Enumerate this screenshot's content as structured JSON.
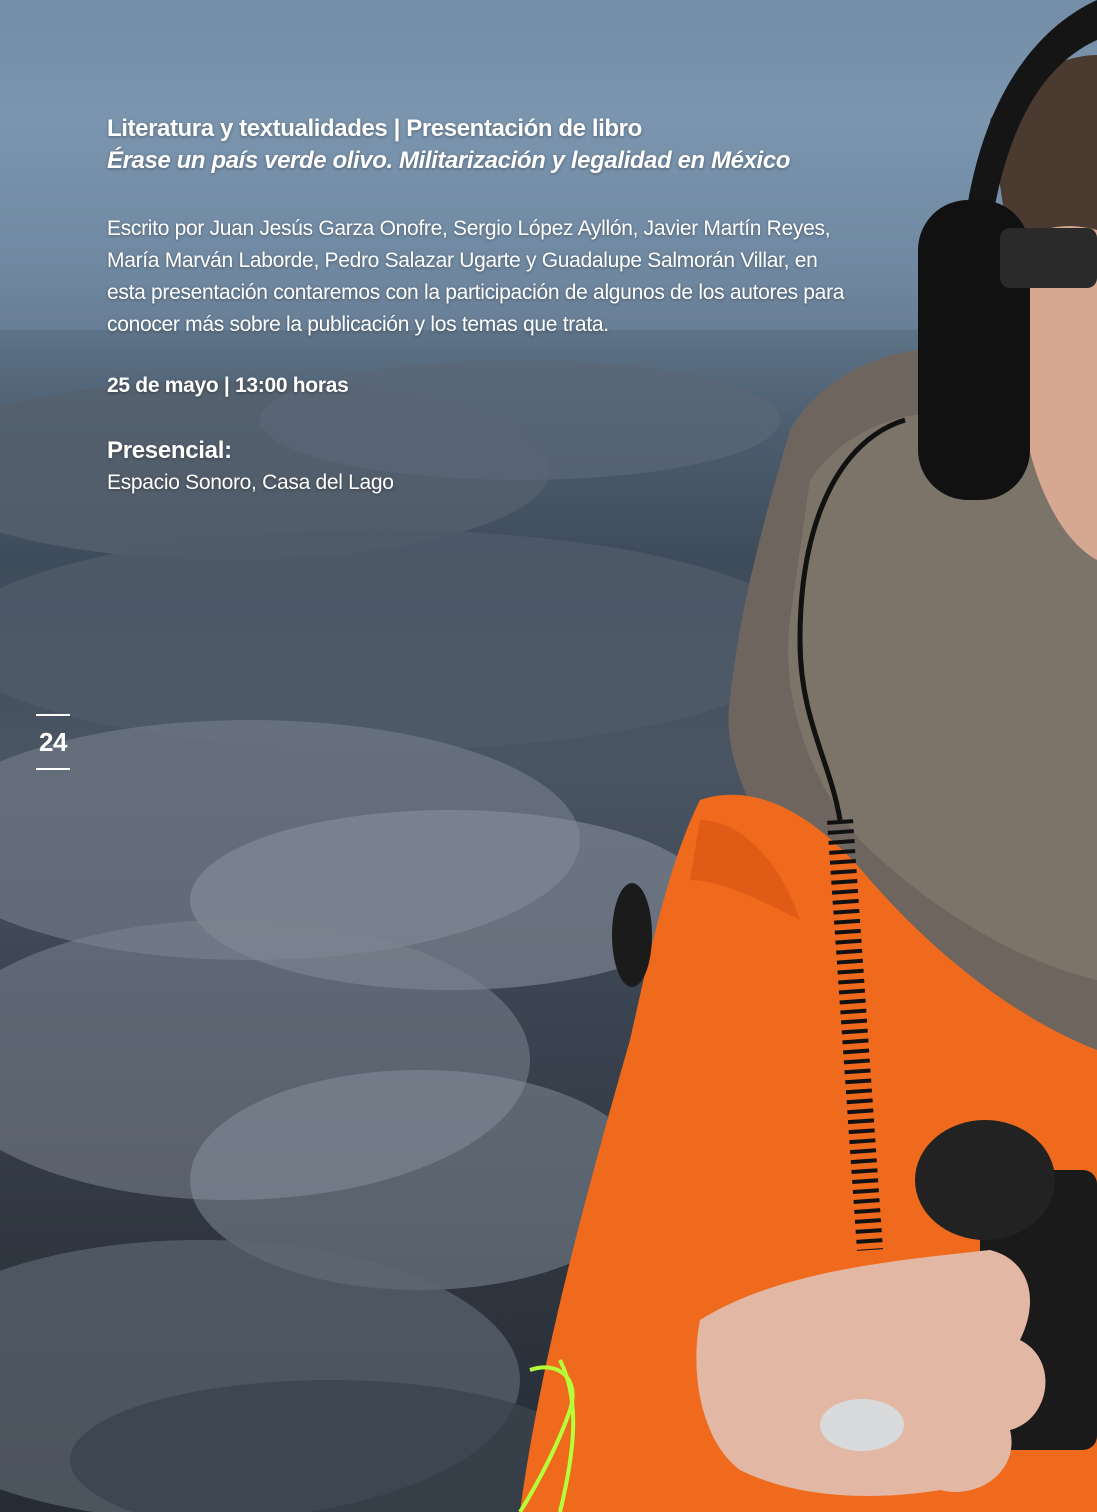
{
  "event": {
    "kicker": "Literatura y textualidades | Presentación de libro",
    "title": "Érase un país verde olivo. Militarización y legalidad en México",
    "description": "Escrito por Juan Jesús Garza Onofre, Sergio López Ayllón, Javier Martín Reyes, María Marván Laborde, Pedro Salazar Ugarte y Guadalupe Salmorán Villar, en esta presentación contaremos con la participación de algunos de los autores para conocer más sobre la publicación y los temas que trata.",
    "schedule": "25 de mayo | 13:00 horas",
    "venue_heading": "Presencial:",
    "venue_name": "Espacio Sonoro, Casa del Lago"
  },
  "page": {
    "number": "24"
  },
  "colors": {
    "text": "#ffffff",
    "jacket": "#f06a1e",
    "fur": "#6e665e",
    "rock": "#4a5563"
  }
}
